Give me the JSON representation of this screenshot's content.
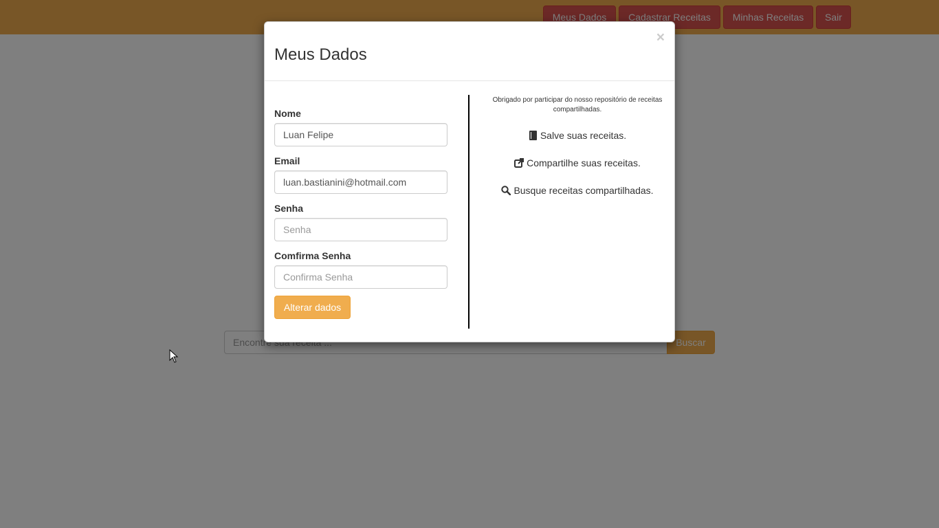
{
  "navbar": {
    "buttons": [
      {
        "label": "Meus Dados"
      },
      {
        "label": "Cadastrar Receitas"
      },
      {
        "label": "Minhas Receitas"
      },
      {
        "label": "Sair"
      }
    ]
  },
  "search": {
    "placeholder": "Encontre sua receita ...",
    "button_label": "Buscar"
  },
  "modal": {
    "title": "Meus Dados",
    "close_symbol": "×",
    "form": {
      "nome_label": "Nome",
      "nome_value": "Luan Felipe",
      "email_label": "Email",
      "email_value": "luan.bastianini@hotmail.com",
      "senha_label": "Senha",
      "senha_placeholder": "Senha",
      "confirma_label": "Comfirma Senha",
      "confirma_placeholder": "Confirma Senha",
      "submit_label": "Alterar dados"
    },
    "info": {
      "thanks": "Obrigado por participar do nosso repositório de receitas compartilhadas.",
      "features": [
        {
          "icon": "book-icon",
          "text": "Salve suas receitas."
        },
        {
          "icon": "share-icon",
          "text": "Compartilhe suas receitas."
        },
        {
          "icon": "search-icon",
          "text": "Busque receitas compartilhadas."
        }
      ]
    }
  },
  "colors": {
    "navbar": "#f0ad4e",
    "danger_button": "#d9534f",
    "warning_button": "#f0ad4e"
  }
}
